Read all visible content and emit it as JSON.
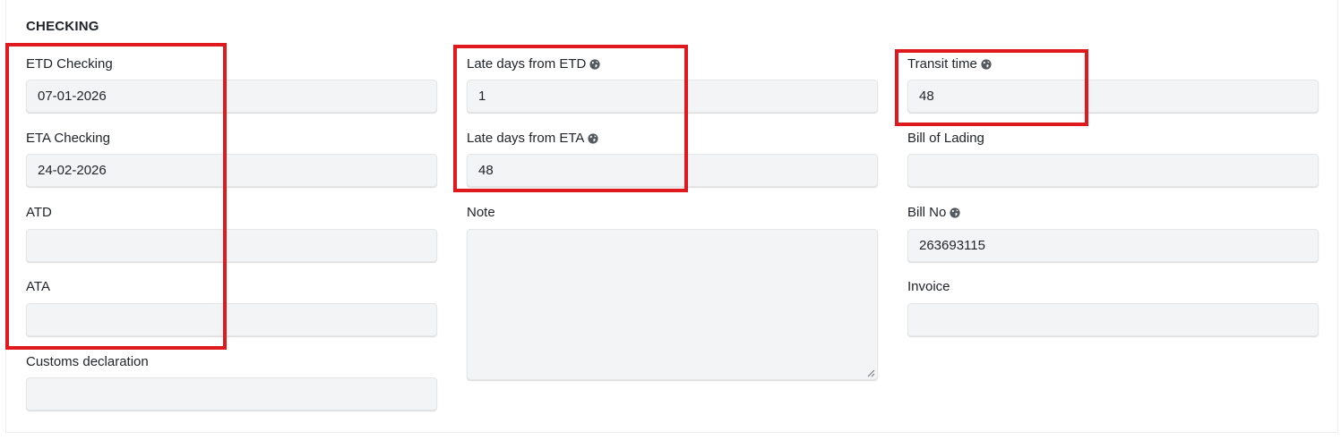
{
  "section": {
    "title": "CHECKING"
  },
  "fields": {
    "etd_checking": {
      "label": "ETD Checking",
      "value": "07-01-2026"
    },
    "eta_checking": {
      "label": "ETA Checking",
      "value": "24-02-2026"
    },
    "atd": {
      "label": "ATD",
      "value": ""
    },
    "ata": {
      "label": "ATA",
      "value": ""
    },
    "customs_declaration": {
      "label": "Customs declaration",
      "value": ""
    },
    "late_days_etd": {
      "label": "Late days from ETD",
      "value": "1",
      "icon": "globe-icon"
    },
    "late_days_eta": {
      "label": "Late days from ETA",
      "value": "48",
      "icon": "globe-icon"
    },
    "note": {
      "label": "Note",
      "value": ""
    },
    "transit_time": {
      "label": "Transit time",
      "value": "48",
      "icon": "globe-icon"
    },
    "bill_of_lading": {
      "label": "Bill of Lading",
      "value": ""
    },
    "bill_no": {
      "label": "Bill No",
      "value": "263693115",
      "icon": "globe-icon"
    },
    "invoice": {
      "label": "Invoice",
      "value": ""
    }
  },
  "colors": {
    "highlight": "#e0191f",
    "input_bg": "#f3f4f5",
    "text": "#212529"
  }
}
